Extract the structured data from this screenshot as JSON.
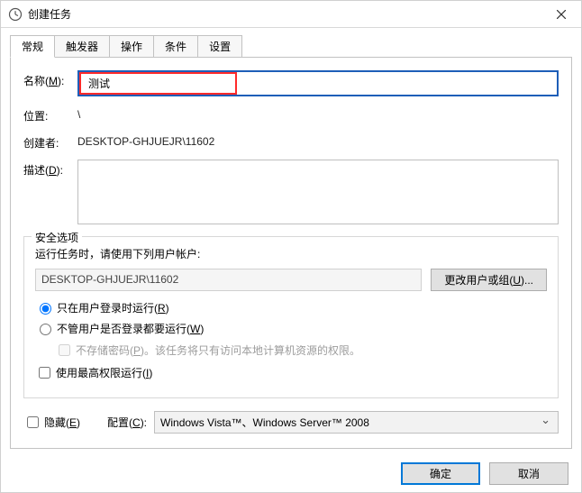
{
  "window": {
    "title": "创建任务"
  },
  "tabs": {
    "general": "常规",
    "triggers": "触发器",
    "actions": "操作",
    "conditions": "条件",
    "settings": "设置"
  },
  "general": {
    "name_label": "名称(M):",
    "name_value": "测试",
    "location_label": "位置:",
    "location_value": "\\",
    "author_label": "创建者:",
    "author_value": "DESKTOP-GHJUEJR\\11602",
    "description_label": "描述(D):",
    "description_value": ""
  },
  "security": {
    "legend": "安全选项",
    "run_as_caption": "运行任务时，请使用下列用户帐户:",
    "account": "DESKTOP-GHJUEJR\\11602",
    "change_user_btn": "更改用户或组(U)...",
    "radio_logged_on": "只在用户登录时运行(R)",
    "radio_any": "不管用户是否登录都要运行(W)",
    "cb_no_store_pwd": "不存储密码(P)。该任务将只有访问本地计算机资源的权限。",
    "cb_highest": "使用最高权限运行(I)"
  },
  "bottom": {
    "cb_hidden": "隐藏(E)",
    "configure_label": "配置(C):",
    "configure_value": "Windows Vista™、Windows Server™ 2008"
  },
  "footer": {
    "ok": "确定",
    "cancel": "取消"
  }
}
